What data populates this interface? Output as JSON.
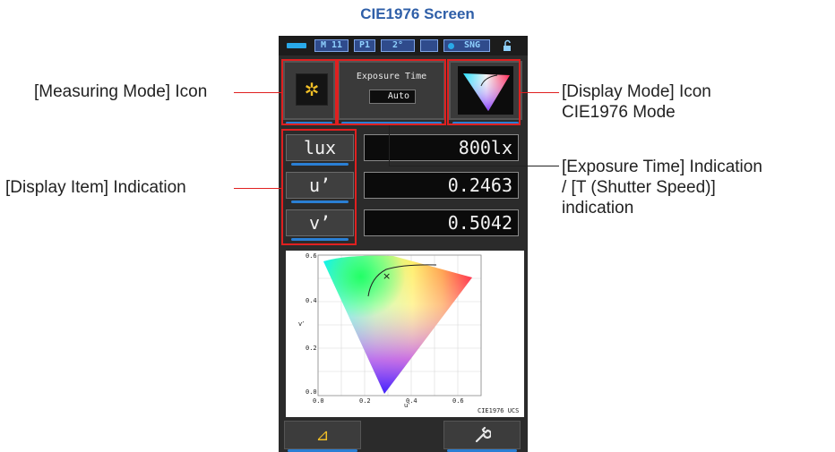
{
  "page_title": "CIE1976 Screen",
  "status_bar": {
    "items": [
      "M 11",
      "P1",
      "2°",
      "SNG"
    ],
    "icons": [
      "battery-icon",
      "blank-chip",
      "dot-icon",
      "lock-icon"
    ]
  },
  "top_icons": {
    "measuring_mode_icon": "sun-star-icon",
    "exposure_time_label": "Exposure Time",
    "exposure_time_value": "Auto",
    "display_mode_icon": "color-triangle-icon"
  },
  "rows": [
    {
      "label": "lux",
      "value": "800lx"
    },
    {
      "label": "u’",
      "value": "0.2463"
    },
    {
      "label": "v’",
      "value": "0.5042"
    }
  ],
  "chart": {
    "title_label": "CIE1976 UCS",
    "xlabel": "u’",
    "ylabel": "v’",
    "xticks": [
      "0.0",
      "0.2",
      "0.4",
      "0.6"
    ],
    "yticks": [
      "0.0",
      "0.2",
      "0.4",
      "0.6"
    ],
    "marker": "×"
  },
  "bottom_buttons": [
    {
      "icon": "delta-icon",
      "glyph": "⊿"
    },
    {
      "icon": "wrench-icon",
      "glyph": "🔧"
    }
  ],
  "annotations": {
    "measuring_mode": "[Measuring Mode] Icon",
    "display_item": "[Display Item] Indication",
    "display_mode_line1": "[Display Mode] Icon",
    "display_mode_line2": "CIE1976 Mode",
    "exposure_line1": "[Exposure Time] Indication",
    "exposure_line2": "/ [T (Shutter Speed)]",
    "exposure_line3": "indication"
  },
  "colors": {
    "accent_blue": "#2f5fa8",
    "annotation_red": "#e02020",
    "status_cyan": "#29a9e9"
  }
}
